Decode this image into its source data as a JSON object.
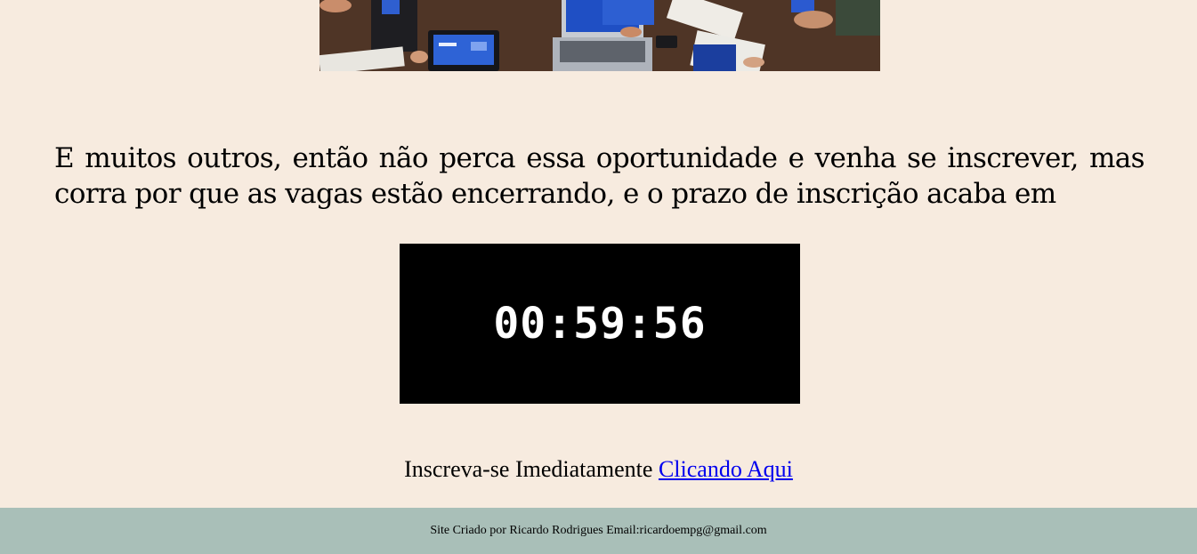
{
  "hero": {
    "image_name": "people-working-with-laptops-and-tablets-photo"
  },
  "intro": {
    "text": "E muitos outros, então não perca essa oportunidade e venha se inscrever, mas corra por que as vagas estão encerrando, e o prazo de inscrição acaba em"
  },
  "countdown": {
    "value": "00:59:56"
  },
  "signup": {
    "prefix": "Inscreva-se Imediatamente ",
    "link_label": "Clicando Aqui"
  },
  "footer": {
    "text": "Site Criado por Ricardo Rodrigues Email:ricardoempg@gmail.com"
  },
  "colors": {
    "page_background": "#f7ebdf",
    "countdown_background": "#000000",
    "countdown_text": "#ffffff",
    "link": "#0000ee",
    "footer_background": "#a9bfb8"
  }
}
